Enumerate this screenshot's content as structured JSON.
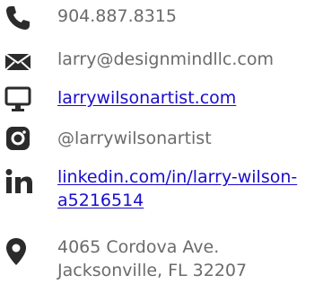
{
  "contact": {
    "phone": "904.887.8315",
    "email": "larry@designmindllc.com",
    "website": "larrywilsonartist.com",
    "instagram": "@larrywilsonartist",
    "linkedin_line1": "linkedin.com/in/larry-wilson-",
    "linkedin_line2": "a5216514",
    "address_line1": "4065 Cordova Ave.",
    "address_line2": "Jacksonville, FL 32207"
  },
  "icons": {
    "phone": "phone-icon",
    "email": "envelope-icon",
    "website": "monitor-icon",
    "instagram": "instagram-icon",
    "linkedin": "linkedin-icon",
    "address": "map-pin-icon"
  },
  "colors": {
    "icon": "#2b2b2b",
    "text": "#6b6b6b",
    "link": "#1a0dcc"
  }
}
